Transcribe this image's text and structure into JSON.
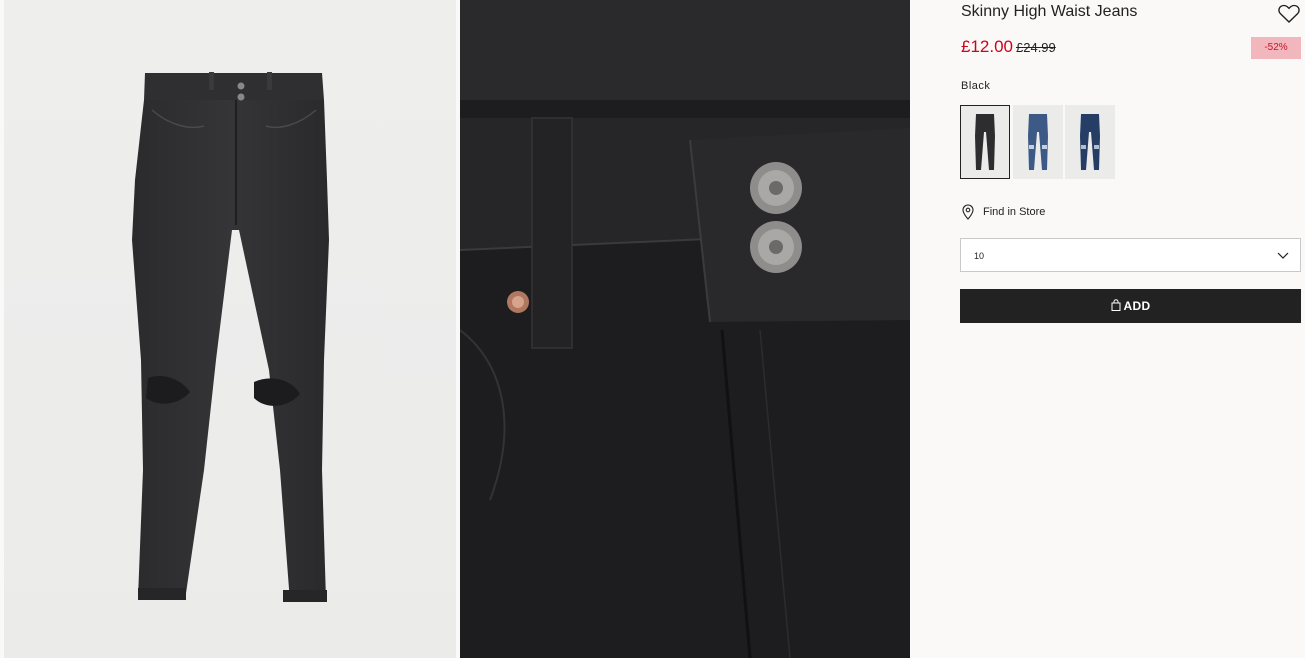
{
  "product": {
    "title": "Skinny High Waist Jeans",
    "price_sale": "£12.00",
    "price_original": "£24.99",
    "discount": "-52%",
    "color_name": "Black",
    "favourite_icon": "heart-icon"
  },
  "swatches": [
    {
      "name": "black",
      "selected": true
    },
    {
      "name": "light-blue-ripped",
      "selected": false
    },
    {
      "name": "dark-blue-ripped",
      "selected": false
    }
  ],
  "store": {
    "label": "Find in Store",
    "icon": "location-pin-icon"
  },
  "size_select": {
    "value": "10",
    "icon": "chevron-down-icon"
  },
  "add_button": {
    "label": "ADD",
    "icon": "shopping-bag-icon"
  },
  "colors": {
    "sale_red": "#d0021b",
    "badge_bg": "#f2b7bc",
    "button_bg": "#222222",
    "page_bg": "#faf9f8"
  }
}
